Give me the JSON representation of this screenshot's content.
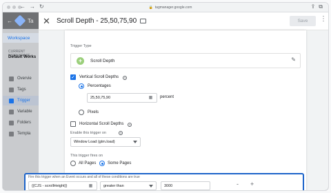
{
  "browser": {
    "url": "tagmanager.google.com"
  },
  "gtm": {
    "title_fragment": "Ta",
    "workspace_tab": "Workspace",
    "current_workspace_label": "CURRENT WORKSPACE",
    "current_workspace_value": "Default Works",
    "nav": [
      {
        "label": "Overvie",
        "active": false
      },
      {
        "label": "Tags",
        "active": false
      },
      {
        "label": "Trigger",
        "active": true
      },
      {
        "label": "Variable",
        "active": false
      },
      {
        "label": "Folders",
        "active": false
      },
      {
        "label": "Templa",
        "active": false
      }
    ]
  },
  "panel": {
    "title": "Scroll Depth - 25,50,75,90",
    "save_label": "Save"
  },
  "trigger": {
    "type_label": "Trigger Type",
    "type_name": "Scroll Depth",
    "vertical_label": "Vertical Scroll Depths",
    "vertical_checked": true,
    "percentages_label": "Percentages",
    "percentages_value": "25,50,75,90",
    "percent_unit": "percent",
    "pixels_label": "Pixels",
    "horizontal_label": "Horizontal Scroll Depths",
    "horizontal_checked": false,
    "enable_label": "Enable this trigger on",
    "enable_value": "Window Load (gtm.load)",
    "fires_label": "This trigger fires on",
    "all_pages_label": "All Pages",
    "some_pages_label": "Some Pages",
    "condition_label": "Fire this trigger when an Event occurs and all of these conditions are true",
    "condition_variable": "{{CJS - scrollHeight}}",
    "condition_operator": "greater than",
    "condition_value": "3000",
    "minus": "-",
    "plus": "+"
  },
  "colors": {
    "accent": "#1a73e8",
    "highlight_border": "#1a62c9",
    "overlay": "#7f8184"
  }
}
